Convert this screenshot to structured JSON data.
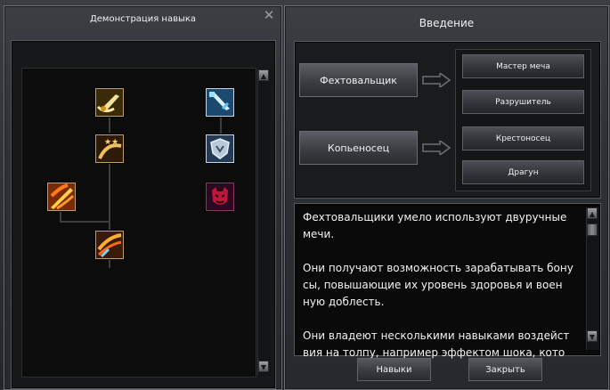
{
  "skill_window": {
    "title": "Демонстрация навыка",
    "close_glyph": "✕",
    "skills": [
      {
        "name": "sword-slash-icon",
        "style": "gold"
      },
      {
        "name": "ice-sword-icon",
        "style": "blue"
      },
      {
        "name": "star-slash-icon",
        "style": "gold"
      },
      {
        "name": "shield-icon",
        "style": "blue"
      },
      {
        "name": "flame-blade-icon",
        "style": "gold"
      },
      {
        "name": "demon-mask-icon",
        "style": "red"
      },
      {
        "name": "fire-strike-icon",
        "style": "gold"
      }
    ],
    "scroll_up": "▲",
    "scroll_down": "▼"
  },
  "intro_window": {
    "title": "Введение",
    "classes": [
      {
        "label": "Фехтовальщик",
        "subclasses": [
          "Мастер меча",
          "Разрушитель"
        ]
      },
      {
        "label": "Копьеносец",
        "subclasses": [
          "Крестоносец",
          "Драгун"
        ]
      }
    ],
    "description": "Фехтовальщики умело используют двуручные мечи.\n\nОни получают возможность зарабатывать бону сы, повышающие их уровень здоровья и воен ную доблесть.\n\nОни владеют несколькими навыками воздейст вия на толпу, например эффектом шока, кото",
    "skills_button": "Навыки",
    "close_button": "Закрыть"
  },
  "colors": {
    "window_bg": "#2d3034",
    "panel_bg": "#111214",
    "button_text": "#f0f0f0",
    "gold_border": "#b9a36a"
  }
}
